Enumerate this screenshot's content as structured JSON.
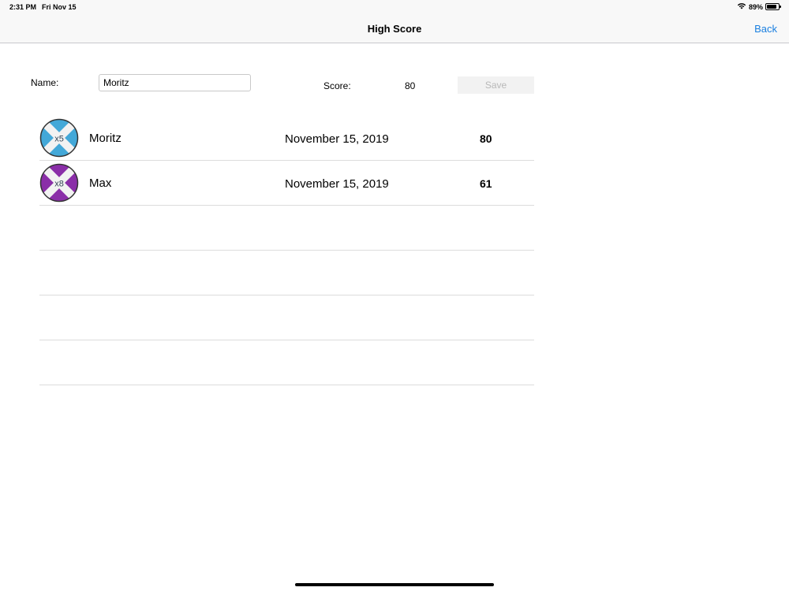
{
  "status_bar": {
    "time": "2:31 PM",
    "date": "Fri Nov 15",
    "battery": "89%",
    "battery_level": 0.89,
    "icons": [
      "wifi-icon",
      "battery-icon"
    ]
  },
  "nav": {
    "title": "High Score",
    "back_label": "Back",
    "accent_color": "#1a7fe0"
  },
  "form": {
    "name_label": "Name:",
    "name_value": "Moritz",
    "score_label": "Score:",
    "score_value": "80",
    "save_label": "Save"
  },
  "scores": [
    {
      "name": "Moritz",
      "date": "November 15, 2019",
      "score": "80",
      "badge": "x5",
      "badge_color": "#43a8d8"
    },
    {
      "name": "Max",
      "date": "November 15, 2019",
      "score": "61",
      "badge": "x8",
      "badge_color": "#8a2ea8"
    }
  ],
  "empty_row_count": 4
}
